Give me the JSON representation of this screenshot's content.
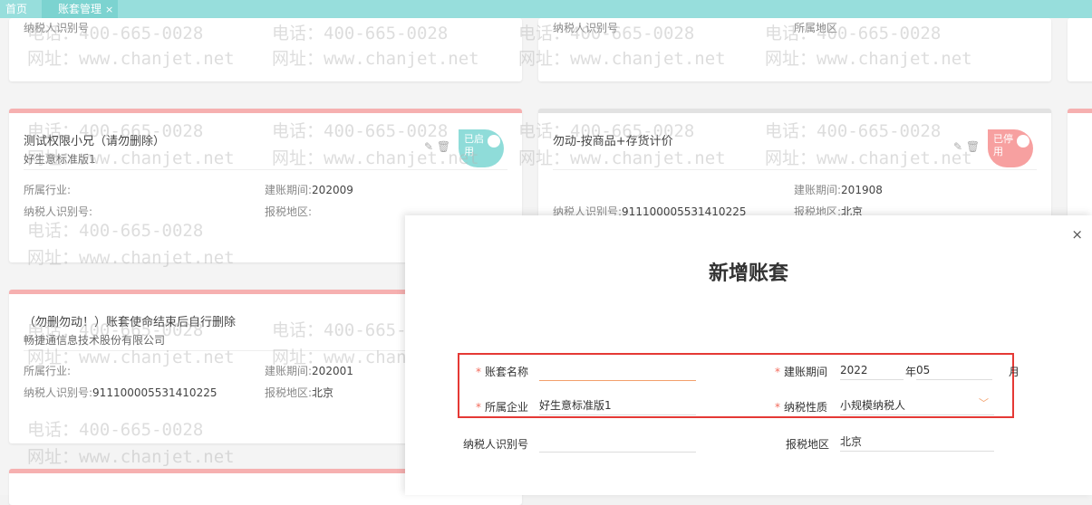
{
  "tabs": {
    "home": "首页",
    "active": "账套管理",
    "close": "×"
  },
  "cards": {
    "c1": {
      "title": "测试权限小兄（请勿删除）",
      "company": "好生意标准版1",
      "industry_label": "所属行业:",
      "period_label": "建账期间:",
      "period_value": "202009",
      "taxid_label": "纳税人识别号:",
      "region_label": "报税地区:",
      "status": "已启用"
    },
    "c2": {
      "title": "勿动-按商品+存货计价",
      "period_label": "建账期间:",
      "period_value": "201908",
      "taxid_label": "纳税人识别号:",
      "taxid_value": "911100005531410225",
      "region_label": "报税地区:",
      "region_value": "北京",
      "status": "已停用"
    },
    "c3": {
      "title": "（勿删勿动！）账套使命结束后自行删除",
      "company": "畅捷通信息技术股份有限公司",
      "industry_label": "所属行业:",
      "period_label": "建账期间:",
      "period_value": "202001",
      "taxid_label": "纳税人识别号:",
      "taxid_value": "911100005531410225",
      "region_label": "报税地区:",
      "region_value": "北京"
    },
    "top_left_partial": "纳税人识别号",
    "top_mid_partial1": "纳税人识别号",
    "top_mid_partial2": "所属地区"
  },
  "watermark": {
    "phone": "电话：400-665-0028",
    "site": "网址：www.chanjet.net"
  },
  "modal": {
    "close": "×",
    "title": "新增账套",
    "name_label": "账套名称",
    "name_value": "",
    "period_label": "建账期间",
    "period_year": "2022",
    "year_unit": "年",
    "period_month": "05",
    "month_unit": "月",
    "company_label": "所属企业",
    "company_value": "好生意标准版1",
    "taxtype_label": "纳税性质",
    "taxtype_value": "小规模纳税人",
    "taxid_label": "纳税人识别号",
    "region_label": "报税地区",
    "region_value": "北京"
  },
  "icons": {
    "edit": "edit-icon",
    "delete": "trash-icon",
    "dropdown": "chevron-down-icon"
  },
  "colors": {
    "topbar": "#97dedc",
    "enabled_badge": "#8fdcd9",
    "disabled_badge": "#f7a0a0",
    "required_star": "#f26b5b",
    "highlight_box": "#e53935"
  }
}
